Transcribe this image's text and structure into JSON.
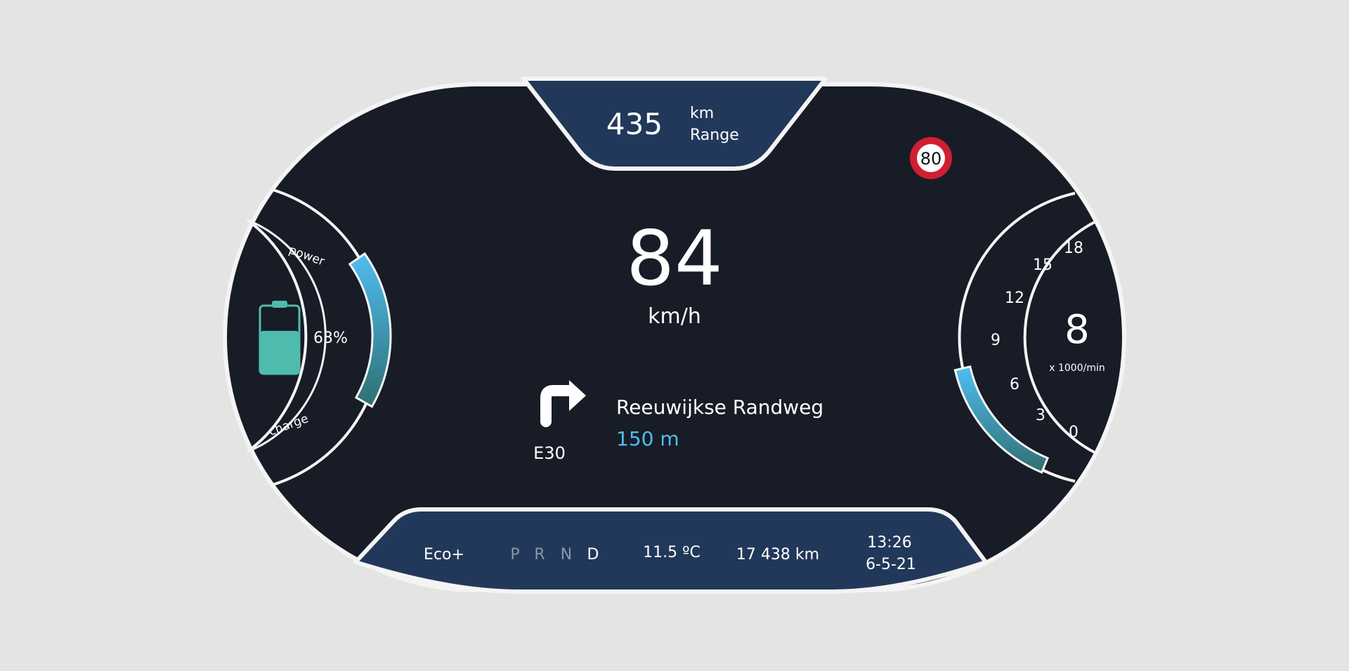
{
  "colors": {
    "page_background": "#e4e4e4",
    "cluster_background": "#171c26",
    "panel_background": "#22385a",
    "outline": "#f4f4f4",
    "battery_fill": "#4fbbad",
    "accent_blue": "#4fbdf0",
    "accent_teal": "#2f6f72",
    "speed_limit_ring": "#cf1f33"
  },
  "range": {
    "value": "435",
    "unit": "km",
    "label": "Range"
  },
  "speed_limit": {
    "value": "80"
  },
  "speed": {
    "value": "84",
    "unit": "km/h"
  },
  "power_gauge": {
    "top_label": "power",
    "bottom_label": "charge",
    "battery_percent": 63,
    "battery_label": "63%",
    "power_level_percent": 45
  },
  "rpm_gauge": {
    "value": "8",
    "unit": "x 1000/min",
    "scale_labels": [
      "0",
      "3",
      "6",
      "9",
      "12",
      "15",
      "18"
    ],
    "level_percent": 40
  },
  "navigation": {
    "arrow_icon": "turn-right-icon",
    "road_number": "E30",
    "street": "Reeuwijkse Randweg",
    "distance": "150 m"
  },
  "bottom_bar": {
    "drive_mode": "Eco+",
    "gears": [
      "P",
      "R",
      "N",
      "D"
    ],
    "active_gear": "D",
    "temperature": "11.5 ºC",
    "odometer": "17 438 km",
    "time": "13:26",
    "date": "6-5-21"
  }
}
